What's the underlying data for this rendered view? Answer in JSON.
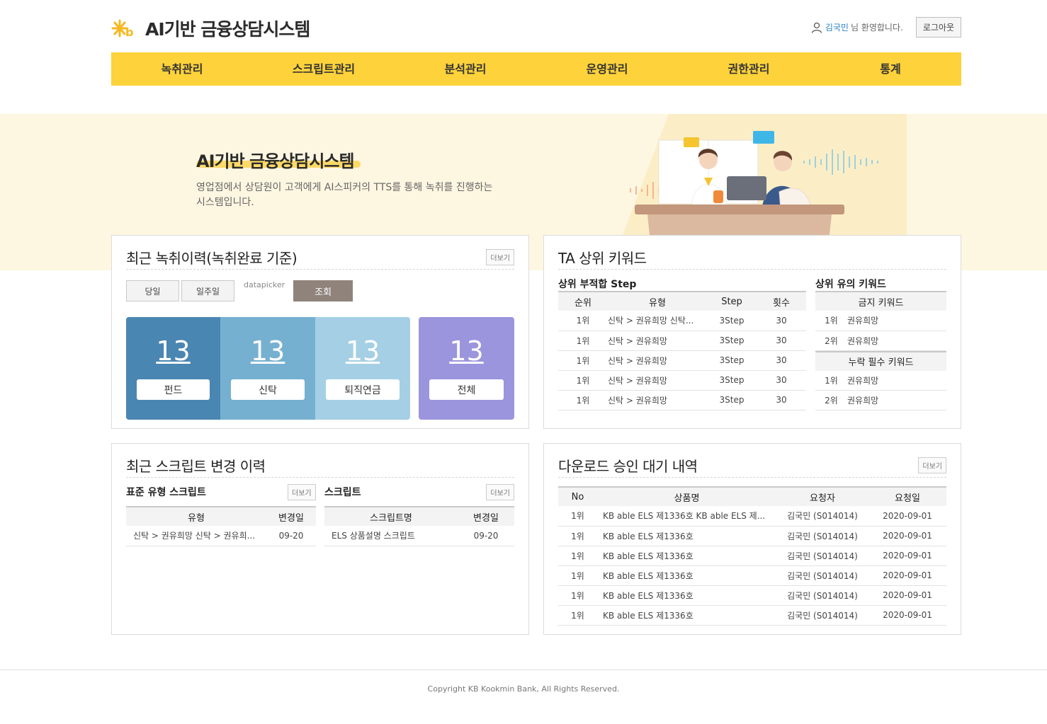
{
  "header": {
    "app_title": "AI기반 금융상담시스템",
    "user_name": "김국민",
    "welcome_text": "님 환영합니다.",
    "logout_label": "로그아웃"
  },
  "nav": [
    "녹취관리",
    "스크립트관리",
    "분석관리",
    "운영관리",
    "권한관리",
    "통계"
  ],
  "hero": {
    "title": "AI기반 금융상담시스템",
    "description": "영업점에서 상담원이 고객에게 AI스피커의 TTS를 통해 녹취를 진행하는 시스템입니다."
  },
  "recent_recording": {
    "title": "최근 녹취이력(녹취완료 기준)",
    "more_label": "더보기",
    "filters": {
      "today": "당일",
      "week": "일주일",
      "datepicker": "datapicker",
      "search": "조회"
    },
    "stats": [
      {
        "value": "13",
        "label": "펀드",
        "color": "#4a86b2"
      },
      {
        "value": "13",
        "label": "신탁",
        "color": "#76b0d0"
      },
      {
        "value": "13",
        "label": "퇴직연금",
        "color": "#a5cfe4"
      }
    ],
    "total": {
      "value": "13",
      "label": "전체",
      "color": "#9b95dd"
    }
  },
  "ta_keywords": {
    "title": "TA 상위 키워드",
    "step_title": "상위 부적합 Step",
    "step_headers": [
      "순위",
      "유형",
      "Step",
      "횟수"
    ],
    "step_rows": [
      [
        "1위",
        "신탁 > 권유희망 신탁...",
        "3Step",
        "30"
      ],
      [
        "1위",
        "신탁 > 권유희망",
        "3Step",
        "30"
      ],
      [
        "1위",
        "신탁 > 권유희망",
        "3Step",
        "30"
      ],
      [
        "1위",
        "신탁 > 권유희망",
        "3Step",
        "30"
      ],
      [
        "1위",
        "신탁 > 권유희망",
        "3Step",
        "30"
      ]
    ],
    "keyword_title": "상위 유의 키워드",
    "forbidden_header": "금지 키워드",
    "forbidden_rows": [
      [
        "1위",
        "권유희망"
      ],
      [
        "2위",
        "권유희망"
      ]
    ],
    "required_header": "누락 필수 키워드",
    "required_rows": [
      [
        "1위",
        "권유희망"
      ],
      [
        "2위",
        "권유희망"
      ]
    ]
  },
  "script_changes": {
    "title": "최근 스크립트 변경 이력",
    "std_title": "표준 유형 스크립트",
    "std_more": "더보기",
    "std_headers": [
      "유형",
      "변경일"
    ],
    "std_rows": [
      [
        "신탁 > 권유희망 신탁 > 권유희...",
        "09-20"
      ]
    ],
    "script_title": "스크립트",
    "script_more": "더보기",
    "script_headers": [
      "스크립트명",
      "변경일"
    ],
    "script_rows": [
      [
        "ELS 상품설명 스크립트",
        "09-20"
      ]
    ]
  },
  "downloads": {
    "title": "다운로드 승인 대기 내역",
    "more_label": "더보기",
    "headers": [
      "No",
      "상품명",
      "요청자",
      "요청일"
    ],
    "rows": [
      [
        "1위",
        "KB able ELS 제1336호 KB able ELS 제...",
        "김국민 (S014014)",
        "2020-09-01"
      ],
      [
        "1위",
        "KB able ELS 제1336호",
        "김국민 (S014014)",
        "2020-09-01"
      ],
      [
        "1위",
        "KB able ELS 제1336호",
        "김국민 (S014014)",
        "2020-09-01"
      ],
      [
        "1위",
        "KB able ELS 제1336호",
        "김국민 (S014014)",
        "2020-09-01"
      ],
      [
        "1위",
        "KB able ELS 제1336호",
        "김국민 (S014014)",
        "2020-09-01"
      ],
      [
        "1위",
        "KB able ELS 제1336호",
        "김국민 (S014014)",
        "2020-09-01"
      ]
    ]
  },
  "footer": {
    "copyright": "Copyright KB Kookmin Bank, All Rights Reserved."
  }
}
